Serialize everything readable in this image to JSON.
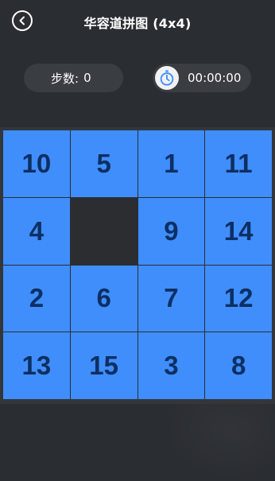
{
  "header": {
    "title": "华容道拼图 (4x4)",
    "back_icon": "chevron-left-icon"
  },
  "stats": {
    "steps_label": "步数:",
    "steps_value": "0",
    "timer_icon": "stopwatch-icon",
    "timer_value": "00:00:00"
  },
  "board": {
    "size": "4x4",
    "tiles": [
      "10",
      "5",
      "1",
      "11",
      "4",
      "",
      "9",
      "14",
      "2",
      "6",
      "7",
      "12",
      "13",
      "15",
      "3",
      "8"
    ],
    "empty_index": 5
  },
  "colors": {
    "background": "#2a2d31",
    "pill": "#3a3d42",
    "tile": "#3f8efc",
    "tile_text": "#0d2f63",
    "empty_tile": "#2b2d31",
    "text": "#ffffff"
  }
}
